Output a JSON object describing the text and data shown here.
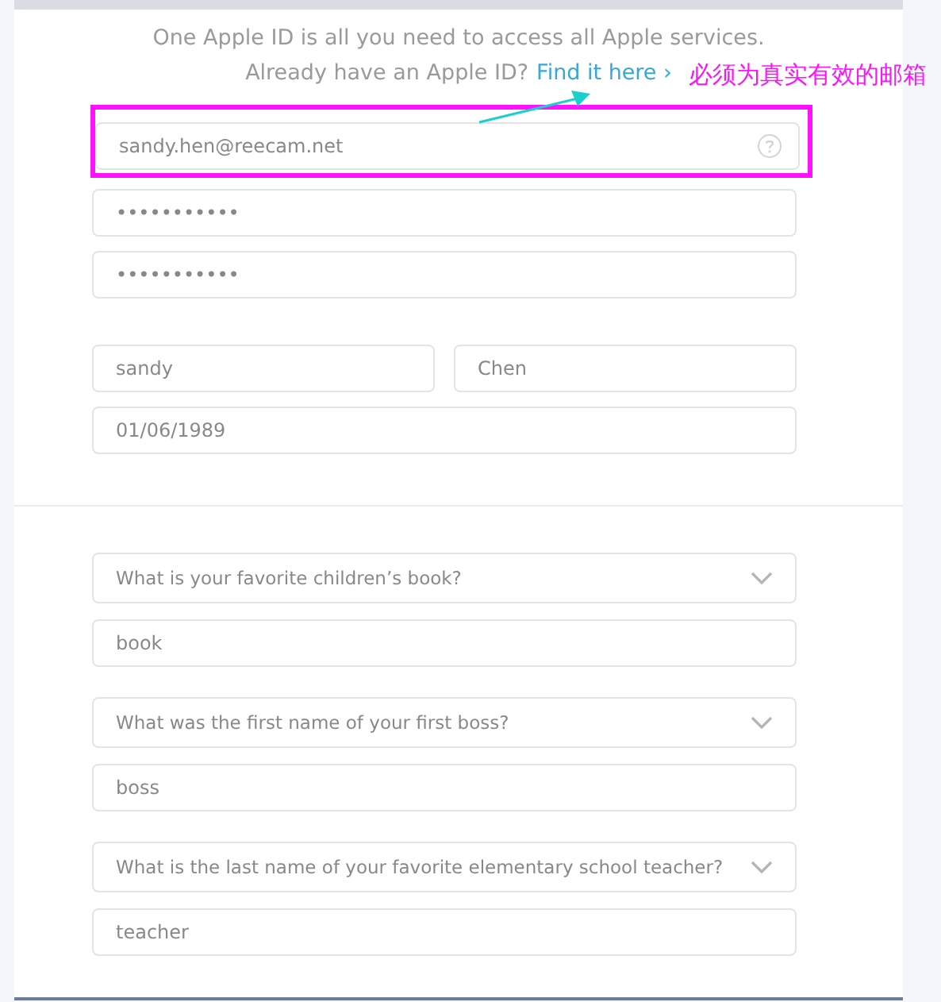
{
  "intro": {
    "line1": "One Apple ID is all you need to access all Apple services.",
    "line2": "Already have an Apple ID?",
    "link": "Find it here ›"
  },
  "annotation": {
    "text": "必须为真实有效的邮箱"
  },
  "email": {
    "value": "sandy.hen@reecam.net",
    "highlighted": true
  },
  "passwords": [
    "•••••••••••",
    "•••••••••••"
  ],
  "first_name": "sandy",
  "last_name": "Chen",
  "birthday": "01/06/1989",
  "security_questions": [
    {
      "question": "What is your favorite children’s book?",
      "answer": "book"
    },
    {
      "question": "What was the first name of your first boss?",
      "answer": "boss"
    },
    {
      "question": "What is the last name of your favorite elementary school teacher?",
      "answer": "teacher"
    }
  ]
}
